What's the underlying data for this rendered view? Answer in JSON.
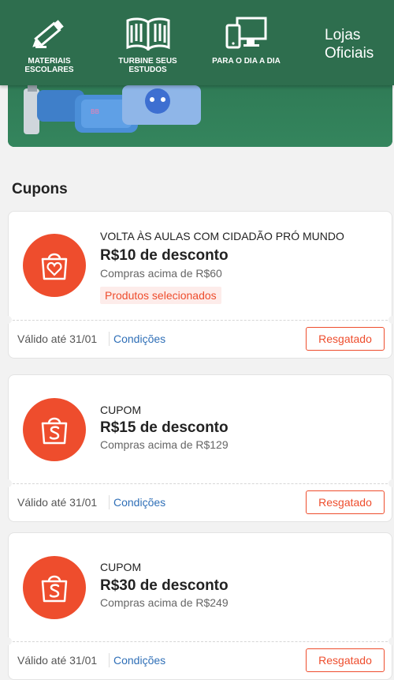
{
  "nav": {
    "items": [
      {
        "label": "MATERIAIS ESCOLARES",
        "icon": "pencil-icon"
      },
      {
        "label": "TURBINE SEUS ESTUDOS",
        "icon": "book-icon"
      },
      {
        "label": "PARA O DIA A DIA",
        "icon": "devices-icon"
      }
    ],
    "lojas_label": "Lojas Oficiais"
  },
  "section_title": "Cupons",
  "colors": {
    "brand": "#ee4d2d",
    "banner_green": "#2e6e4e",
    "link": "#2f6fb7"
  },
  "coupons": [
    {
      "label": "VOLTA ÀS AULAS COM CIDADÃO PRÓ MUNDO",
      "title": "R$10 de desconto",
      "min": "Compras acima de R$60",
      "tag": "Produtos selecionados",
      "valid": "Válido até 31/01",
      "conditions": "Condições",
      "button": "Resgatado",
      "icon": "shopping-bag-heart-icon"
    },
    {
      "label": "CUPOM",
      "title": "R$15 de desconto",
      "min": "Compras acima de R$129",
      "valid": "Válido até 31/01",
      "conditions": "Condições",
      "button": "Resgatado",
      "icon": "shopee-bag-icon"
    },
    {
      "label": "CUPOM",
      "title": "R$30 de desconto",
      "min": "Compras acima de R$249",
      "valid": "Válido até 31/01",
      "conditions": "Condições",
      "button": "Resgatado",
      "icon": "shopee-bag-icon"
    }
  ]
}
